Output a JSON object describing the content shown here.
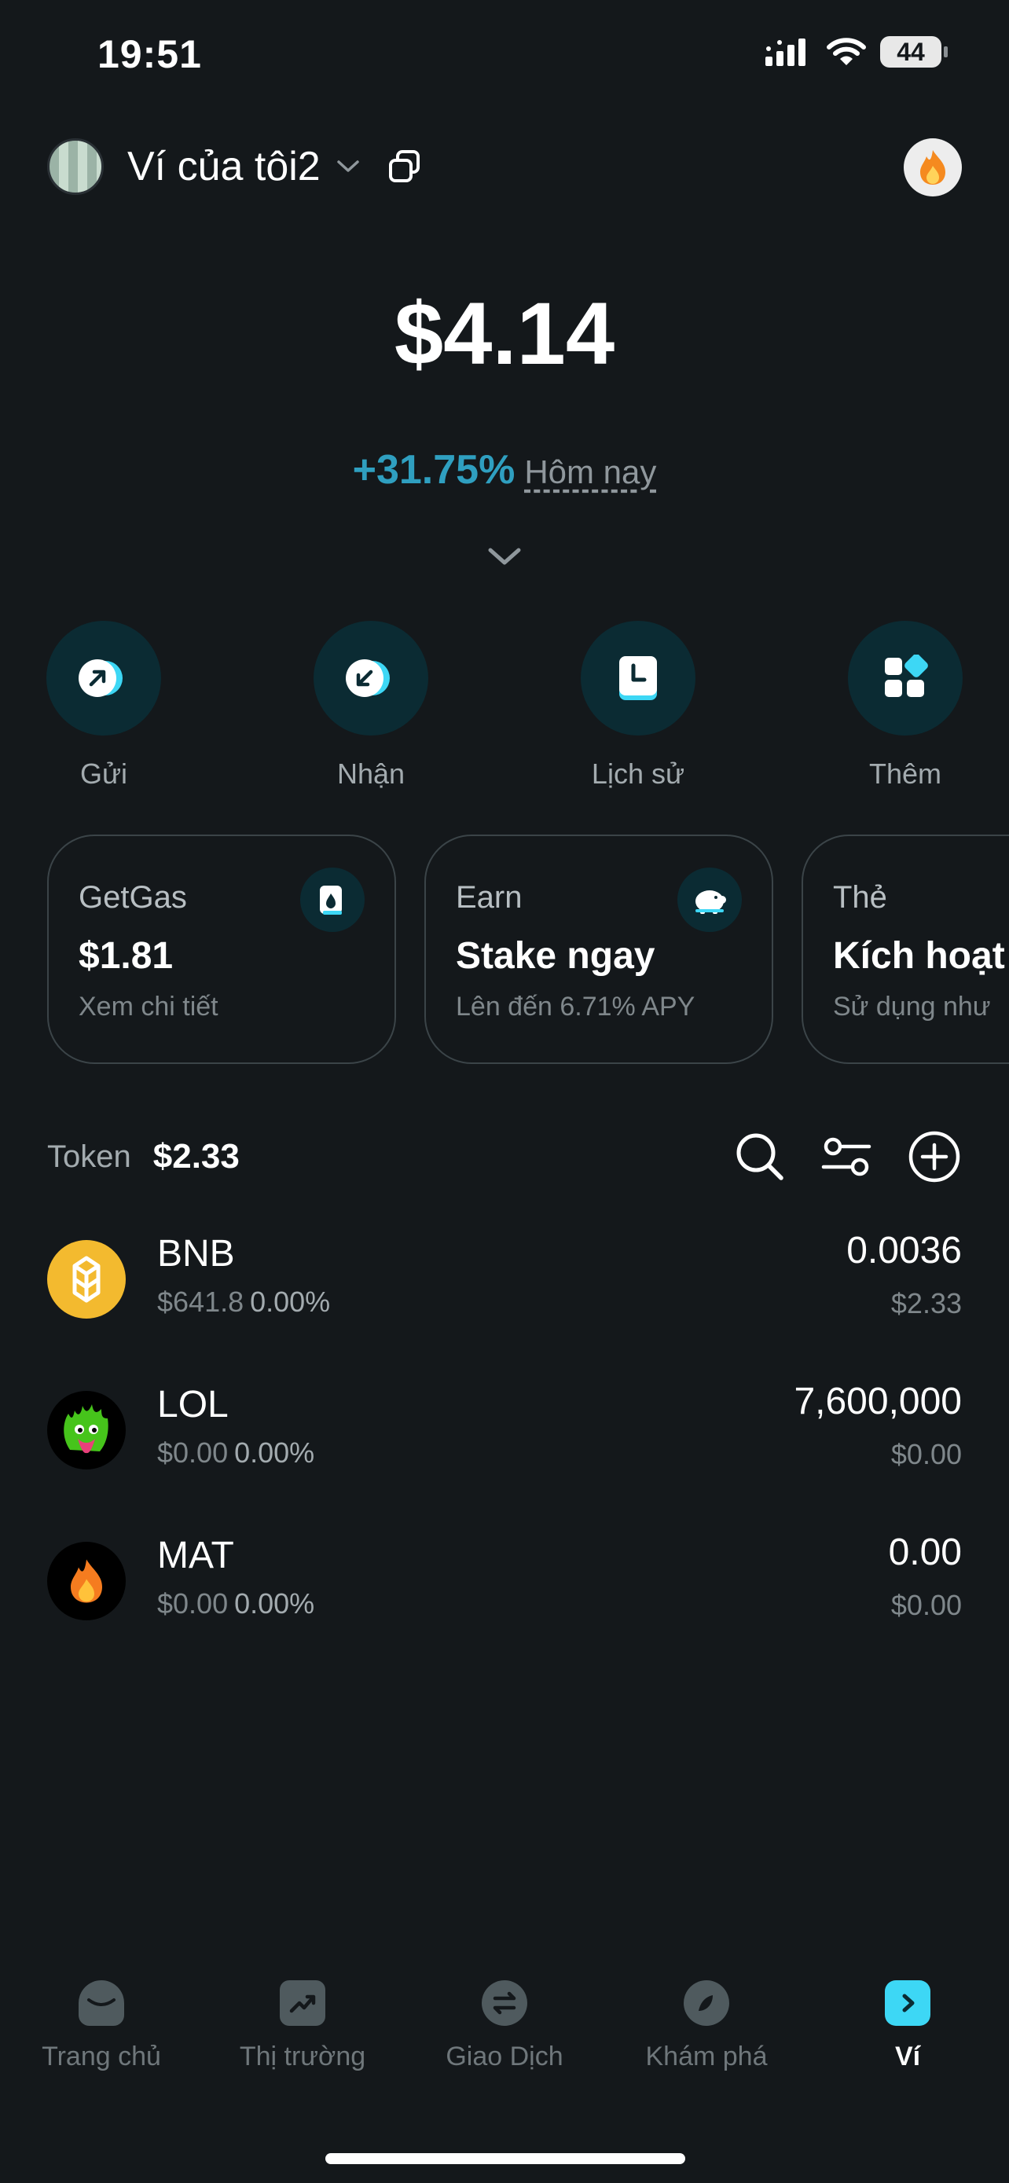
{
  "status_bar": {
    "time": "19:51",
    "battery": "44"
  },
  "header": {
    "wallet_name": "Ví của tôi2"
  },
  "balance": {
    "amount": "$4.14",
    "change_pct": "+31.75%",
    "change_label": "Hôm nay"
  },
  "actions": [
    {
      "label": "Gửi",
      "icon": "send-icon"
    },
    {
      "label": "Nhận",
      "icon": "receive-icon"
    },
    {
      "label": "Lịch sử",
      "icon": "history-icon"
    },
    {
      "label": "Thêm",
      "icon": "more-icon"
    }
  ],
  "cards": [
    {
      "title": "GetGas",
      "value": "$1.81",
      "sub": "Xem chi tiết",
      "icon": "gas-icon"
    },
    {
      "title": "Earn",
      "value": "Stake ngay",
      "sub": "Lên đến 6.71% APY",
      "icon": "piggy-bank-icon"
    },
    {
      "title": "Thẻ",
      "value": "Kích hoạt",
      "sub": "Sử dụng như"
    }
  ],
  "tokens_header": {
    "label": "Token",
    "total": "$2.33"
  },
  "tokens": [
    {
      "name": "BNB",
      "price": "$641.8",
      "pct": "0.00%",
      "amount": "0.0036",
      "value": "$2.33",
      "color": "#f3ba2f"
    },
    {
      "name": "LOL",
      "price": "$0.00",
      "pct": "0.00%",
      "amount": "7,600,000",
      "value": "$0.00",
      "color": "#000000"
    },
    {
      "name": "MAT",
      "price": "$0.00",
      "pct": "0.00%",
      "amount": "0.00",
      "value": "$0.00",
      "color": "#000000"
    }
  ],
  "nav": [
    {
      "label": "Trang chủ",
      "icon": "home-icon"
    },
    {
      "label": "Thị trường",
      "icon": "market-icon"
    },
    {
      "label": "Giao Dịch",
      "icon": "trade-icon"
    },
    {
      "label": "Khám phá",
      "icon": "explore-icon"
    },
    {
      "label": "Ví",
      "icon": "wallet-icon",
      "active": true
    }
  ],
  "colors": {
    "accent": "#2f9fc0",
    "background": "#14181b",
    "action_bg": "#0b2b33"
  }
}
